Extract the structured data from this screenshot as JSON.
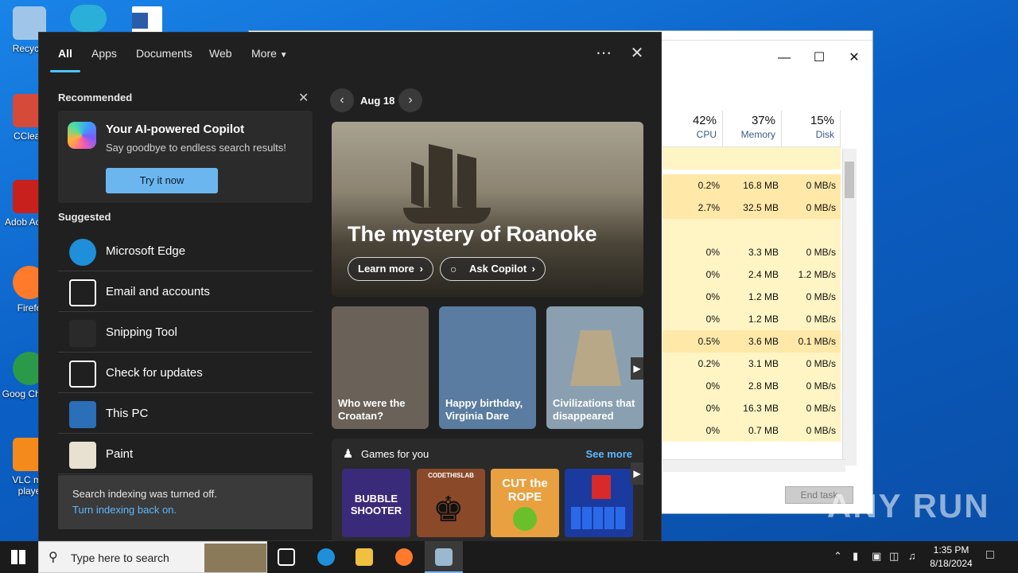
{
  "desktop": {
    "icons": [
      {
        "label": "Recycle",
        "color": "#9fc6e8"
      },
      {
        "label": "CClean",
        "color": "#d64a3a"
      },
      {
        "label": "Adob Acrob",
        "color": "#c8201c"
      },
      {
        "label": "Firefo",
        "color": "#ff7a2a"
      },
      {
        "label": "Goog Chrom",
        "color": "#2a9a4a"
      },
      {
        "label": "VLC me playe",
        "color": "#f48a1a"
      }
    ]
  },
  "taskmgr": {
    "columns": [
      {
        "pct": "42%",
        "label": "CPU"
      },
      {
        "pct": "37%",
        "label": "Memory"
      },
      {
        "pct": "15%",
        "label": "Disk"
      }
    ],
    "rows": [
      {
        "cpu": "",
        "mem": "",
        "disk": ""
      },
      {
        "cpu": "0.2%",
        "mem": "16.8 MB",
        "disk": "0 MB/s"
      },
      {
        "cpu": "2.7%",
        "mem": "32.5 MB",
        "disk": "0 MB/s"
      },
      {
        "cpu": "",
        "mem": "",
        "disk": ""
      },
      {
        "cpu": "0%",
        "mem": "3.3 MB",
        "disk": "0 MB/s"
      },
      {
        "cpu": "0%",
        "mem": "2.4 MB",
        "disk": "1.2 MB/s"
      },
      {
        "cpu": "0%",
        "mem": "1.2 MB",
        "disk": "0 MB/s"
      },
      {
        "cpu": "0%",
        "mem": "1.2 MB",
        "disk": "0 MB/s"
      },
      {
        "cpu": "0.5%",
        "mem": "3.6 MB",
        "disk": "0.1 MB/s"
      },
      {
        "cpu": "0.2%",
        "mem": "3.1 MB",
        "disk": "0 MB/s"
      },
      {
        "cpu": "0%",
        "mem": "2.8 MB",
        "disk": "0 MB/s"
      },
      {
        "cpu": "0%",
        "mem": "16.3 MB",
        "disk": "0 MB/s"
      },
      {
        "cpu": "0%",
        "mem": "0.7 MB",
        "disk": "0 MB/s"
      }
    ],
    "end_task": "End task"
  },
  "search_panel": {
    "tabs": [
      "All",
      "Apps",
      "Documents",
      "Web",
      "More"
    ],
    "recommended_title": "Recommended",
    "copilot": {
      "title": "Your AI-powered Copilot",
      "subtitle": "Say goodbye to endless search results!",
      "button": "Try it now"
    },
    "suggested_title": "Suggested",
    "suggested": [
      {
        "label": "Microsoft Edge",
        "icon": "edge-icon",
        "color": "#1e8fd8"
      },
      {
        "label": "Email and accounts",
        "icon": "mail-icon",
        "color": "#202020"
      },
      {
        "label": "Snipping Tool",
        "icon": "scissors-icon",
        "color": "#2a2a2a"
      },
      {
        "label": "Check for updates",
        "icon": "refresh-icon",
        "color": "#202020"
      },
      {
        "label": "This PC",
        "icon": "computer-icon",
        "color": "#2a6fb8"
      },
      {
        "label": "Paint",
        "icon": "palette-icon",
        "color": "#e8e0d0"
      }
    ],
    "indexing": {
      "line1": "Search indexing was turned off.",
      "line2": "Turn indexing back on."
    },
    "date": "Aug 18",
    "hero": {
      "title": "The mystery of Roanoke",
      "learn_more": "Learn more",
      "ask_copilot": "Ask Copilot"
    },
    "thumbs": [
      {
        "caption": "Who were the Croatan?",
        "bg": "#6a6258"
      },
      {
        "caption": "Happy birthday, Virginia Dare",
        "bg": "#5a7ca0"
      },
      {
        "caption": "Civilizations that disappeared",
        "bg": "#8aa0b0"
      }
    ],
    "games": {
      "title": "Games for you",
      "see_more": "See more",
      "items": [
        {
          "label": "BUBBLE SHOOTER",
          "bg": "#3a2a7a"
        },
        {
          "label": "CODETHISLAB",
          "bg": "#8a4a2a"
        },
        {
          "label": "CUT the ROPE",
          "bg": "#e8a040"
        },
        {
          "label": "",
          "bg": "#1a3aa0"
        }
      ]
    }
  },
  "taskbar": {
    "search_placeholder": "Type here to search",
    "time": "1:35 PM",
    "date": "8/18/2024"
  },
  "watermark": "ANY RUN"
}
